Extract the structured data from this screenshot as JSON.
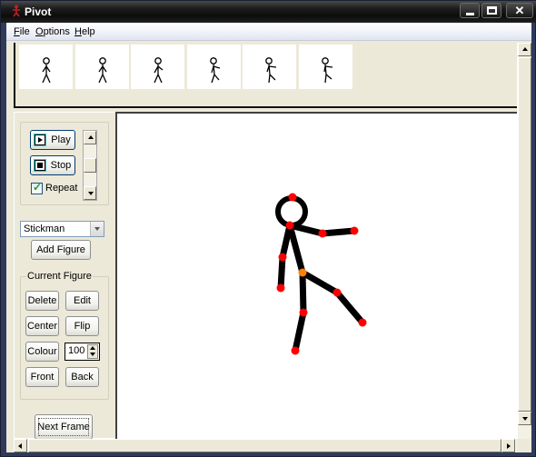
{
  "window": {
    "title": "Pivot",
    "controls": {
      "minimize": "minimize",
      "maximize": "maximize",
      "close": "close"
    }
  },
  "menu": {
    "items": [
      {
        "label": "File",
        "accel": "F"
      },
      {
        "label": "Options",
        "accel": "O"
      },
      {
        "label": "Help",
        "accel": "H"
      }
    ]
  },
  "timeline": {
    "frame_count": 6,
    "frames": [
      {
        "index": 1,
        "pose": "standing"
      },
      {
        "index": 2,
        "pose": "standing"
      },
      {
        "index": 3,
        "pose": "arm-raise"
      },
      {
        "index": 4,
        "pose": "arm-out"
      },
      {
        "index": 5,
        "pose": "kick-start"
      },
      {
        "index": 6,
        "pose": "kick"
      }
    ]
  },
  "playback": {
    "play_label": "Play",
    "stop_label": "Stop",
    "repeat_label": "Repeat",
    "repeat_checked": true
  },
  "figure_select": {
    "selected": "Stickman",
    "add_label": "Add Figure"
  },
  "current_figure": {
    "group_label": "Current Figure",
    "delete_label": "Delete",
    "edit_label": "Edit",
    "center_label": "Center",
    "flip_label": "Flip",
    "colour_label": "Colour",
    "size_value": "100",
    "front_label": "Front",
    "back_label": "Back"
  },
  "next_frame_label": "Next Frame",
  "colors": {
    "joint": "#ff0000",
    "root_joint": "#ff8000",
    "limb": "#000000"
  }
}
